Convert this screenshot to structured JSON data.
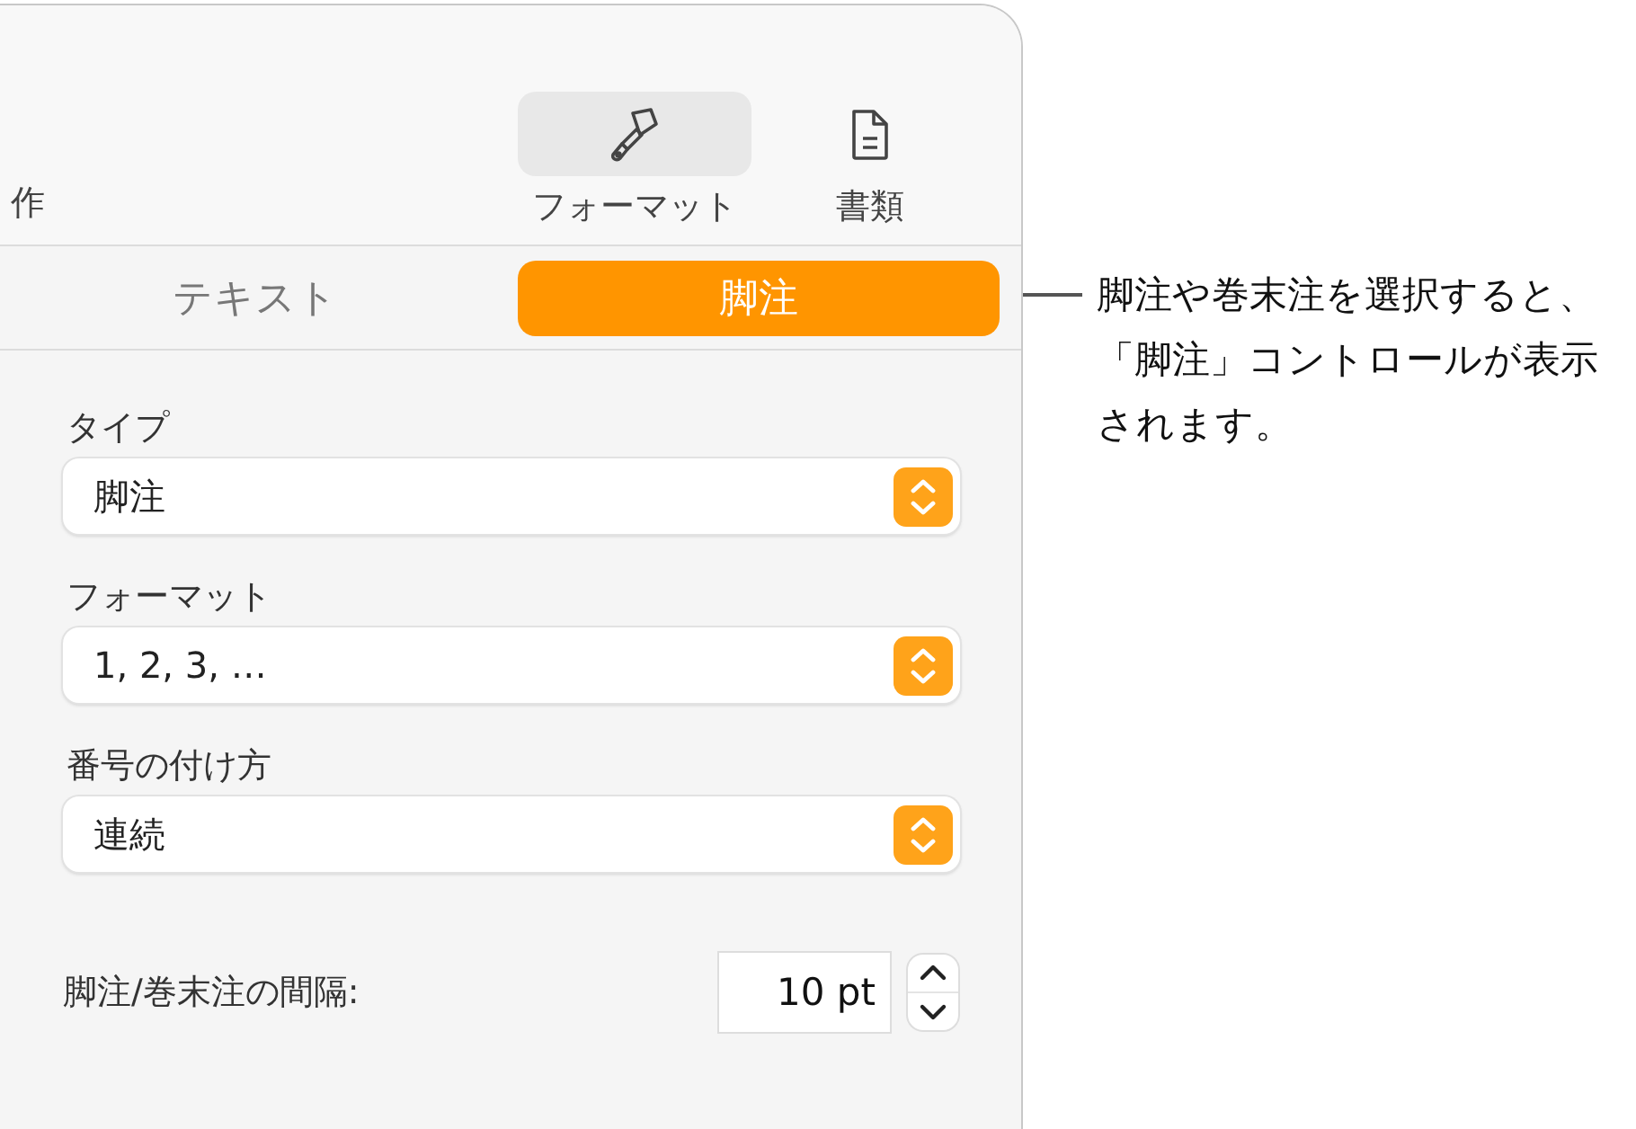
{
  "toolbar": {
    "left_label": "作",
    "buttons": [
      {
        "label": "フォーマット",
        "kind": "brush",
        "selected": true
      },
      {
        "label": "書類",
        "kind": "document",
        "selected": false
      }
    ]
  },
  "tabs": [
    {
      "label": "テキスト",
      "selected": false
    },
    {
      "label": "脚注",
      "selected": true
    }
  ],
  "fields": [
    {
      "label": "タイプ",
      "value": "脚注"
    },
    {
      "label": "フォーマット",
      "value": "1, 2, 3, …"
    },
    {
      "label": "番号の付け方",
      "value": "連続"
    }
  ],
  "spacing": {
    "label": "脚注/巻末注の間隔:",
    "value": "10 pt"
  },
  "callout": "脚注や巻末注を選択すると、「脚注」コントロールが表示されます。"
}
